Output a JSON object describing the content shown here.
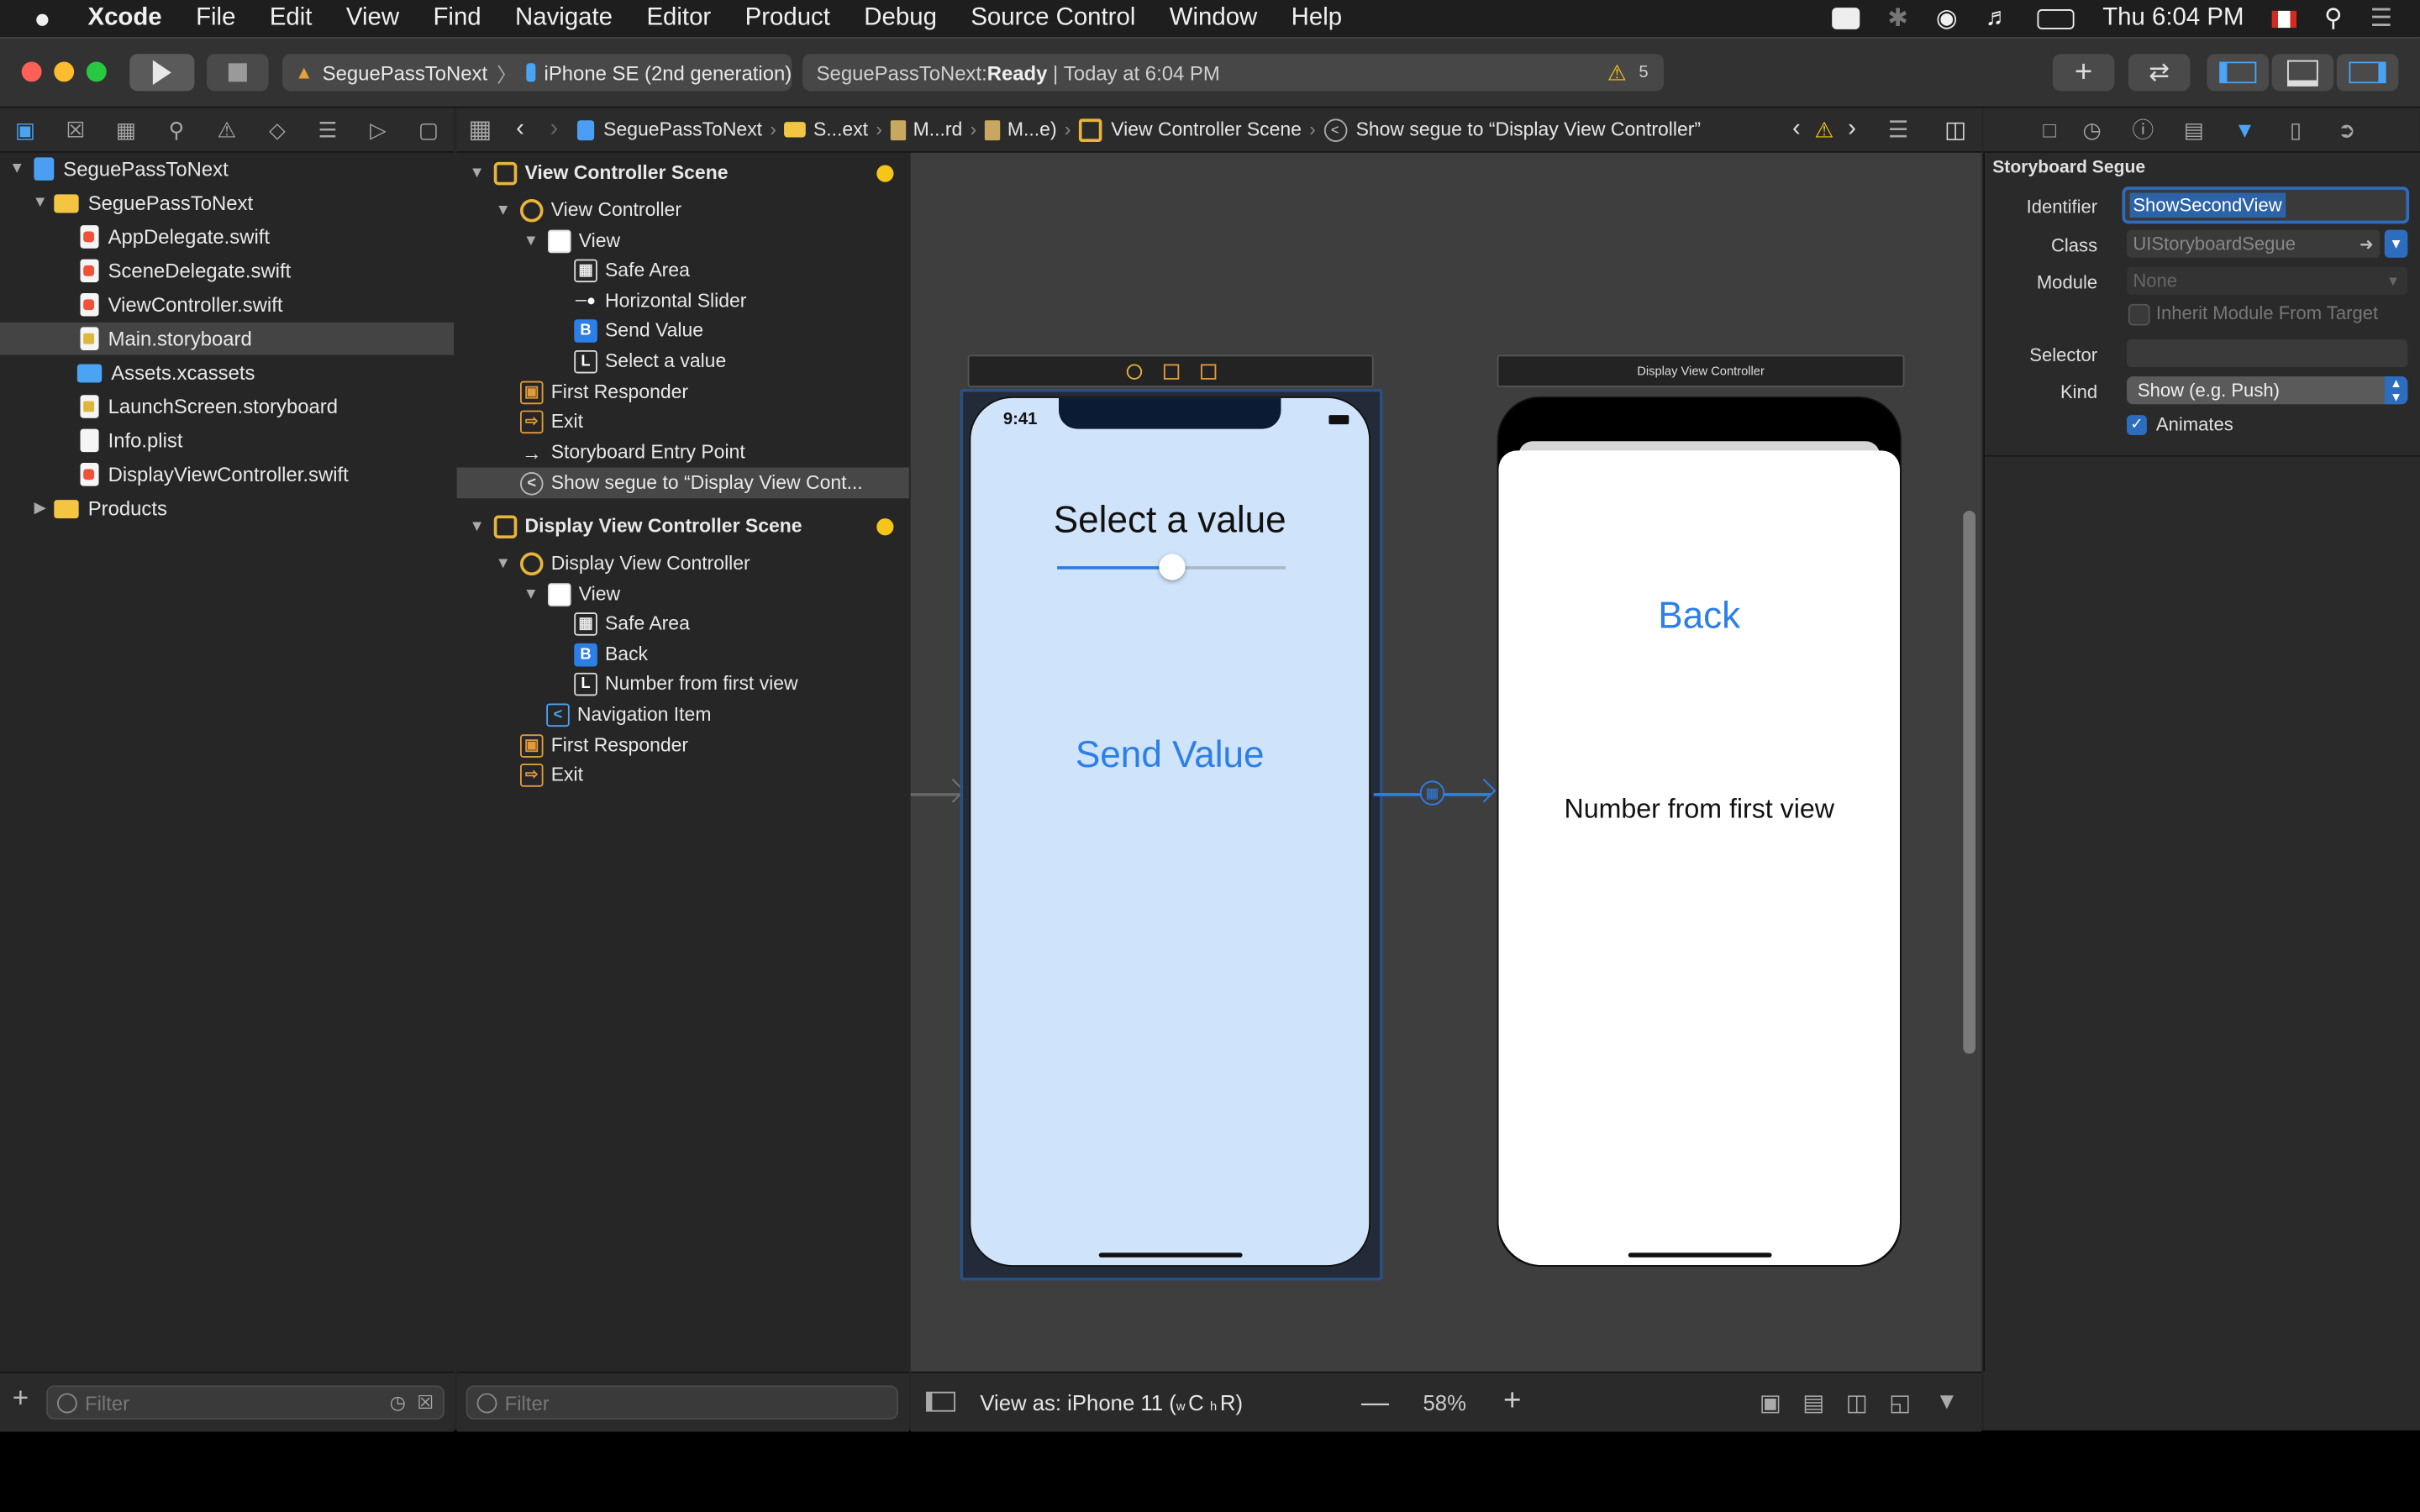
{
  "menubar": {
    "apple": "",
    "app": "Xcode",
    "items": [
      "File",
      "Edit",
      "View",
      "Find",
      "Navigate",
      "Editor",
      "Product",
      "Debug",
      "Source Control",
      "Window",
      "Help"
    ],
    "clock": "Thu 6:04 PM"
  },
  "toolbar": {
    "scheme": "SeguePassToNext",
    "device": "iPhone SE (2nd generation)",
    "status_project": "SeguePassToNext: ",
    "status_state": "Ready",
    "status_sep": " | ",
    "status_time": "Today at 6:04 PM",
    "warning_count": "5"
  },
  "navigator": {
    "project": "SeguePassToNext",
    "group": "SeguePassToNext",
    "files": [
      "AppDelegate.swift",
      "SceneDelegate.swift",
      "ViewController.swift",
      "Main.storyboard",
      "Assets.xcassets",
      "LaunchScreen.storyboard",
      "Info.plist",
      "DisplayViewController.swift"
    ],
    "products": "Products",
    "filter_placeholder": "Filter"
  },
  "jumpbar": {
    "crumbs": [
      "SeguePassToNext",
      "S...ext",
      "M...rd",
      "M...e)",
      "View Controller Scene",
      "Show segue to “Display View Controller”"
    ]
  },
  "outline": {
    "scene1": {
      "title": "View Controller Scene",
      "controller": "View Controller",
      "view": "View",
      "safe_area": "Safe Area",
      "slider": "Horizontal Slider",
      "button": "Send Value",
      "label": "Select a value",
      "first_responder": "First Responder",
      "exit": "Exit",
      "entry_point": "Storyboard Entry Point",
      "segue": "Show segue to “Display View Cont..."
    },
    "scene2": {
      "title": "Display View Controller Scene",
      "controller": "Display View Controller",
      "view": "View",
      "safe_area": "Safe Area",
      "back": "Back",
      "label": "Number from first view",
      "nav_item": "Navigation Item",
      "first_responder": "First Responder",
      "exit": "Exit"
    },
    "filter_placeholder": "Filter"
  },
  "canvas": {
    "phone1": {
      "time": "9:41",
      "label": "Select a value",
      "button": "Send Value",
      "slider_value": 0.5
    },
    "phone2": {
      "header": "Display View Controller",
      "back": "Back",
      "label": "Number from first view"
    },
    "view_as": "View as: iPhone 11 (",
    "size_w": "w",
    "size_c": "C",
    "size_h": "h",
    "size_r": "R)",
    "zoom": "58%"
  },
  "inspector": {
    "section": "Storyboard Segue",
    "identifier_label": "Identifier",
    "identifier_value": "ShowSecondView",
    "class_label": "Class",
    "class_placeholder": "UIStoryboardSegue",
    "module_label": "Module",
    "module_placeholder": "None",
    "inherit_label": "Inherit Module From Target",
    "selector_label": "Selector",
    "kind_label": "Kind",
    "kind_value": "Show (e.g. Push)",
    "animates_label": "Animates",
    "animates_checked": true
  },
  "colors": {
    "accent": "#2d7fe8",
    "phone1_bg": "#cfe3fa",
    "warning": "#f5c518"
  }
}
